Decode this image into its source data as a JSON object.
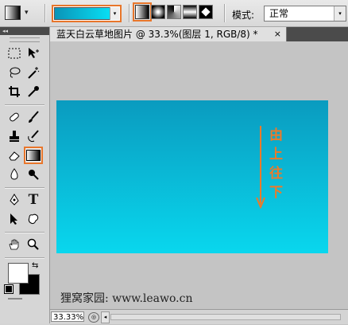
{
  "options_bar": {
    "tool_preset_icon": "gradient-tool-icon",
    "tool_preset_arrow": "▾",
    "gradient": {
      "start_color": "#0a94b8",
      "end_color": "#08dff4",
      "arrow": "▾"
    },
    "gradient_types": [
      "linear",
      "radial",
      "angle",
      "reflected",
      "diamond"
    ],
    "selected_gradient_type": "linear",
    "mode_label": "模式:",
    "mode_value": "正常",
    "mode_arrow": "▾"
  },
  "toolbox": {
    "collapse_label": "◂◂",
    "tools": [
      [
        "marquee-icon",
        "move-icon"
      ],
      [
        "lasso-icon",
        "magic-wand-icon"
      ],
      [
        "crop-icon",
        "eyedropper-icon"
      ],
      [
        "healing-brush-icon",
        "brush-icon"
      ],
      [
        "clone-stamp-icon",
        "history-brush-icon"
      ],
      [
        "eraser-icon",
        "gradient-icon"
      ],
      [
        "blur-icon",
        "dodge-icon"
      ],
      [
        "pen-icon",
        "type-icon"
      ],
      [
        "path-select-icon",
        "custom-shape-icon"
      ],
      [
        "hand-icon",
        "zoom-icon"
      ]
    ],
    "selected_tool": "gradient-icon",
    "foreground_color": "#ffffff",
    "background_color": "#000000"
  },
  "document": {
    "title": "蓝天白云草地图片 @ 33.3%(图层 1, RGB/8) *",
    "close": "×",
    "canvas_gradient": {
      "top": "#0a9bbf",
      "bottom": "#09d7ee"
    },
    "annotation_chars": [
      "由",
      "上",
      "往",
      "下"
    ],
    "annotation_color": "#ec7a2a",
    "watermark": "狸窝家园: www.leawo.cn",
    "zoom": "33.33%",
    "nav_left": "◂",
    "nav_icon": "◎"
  }
}
